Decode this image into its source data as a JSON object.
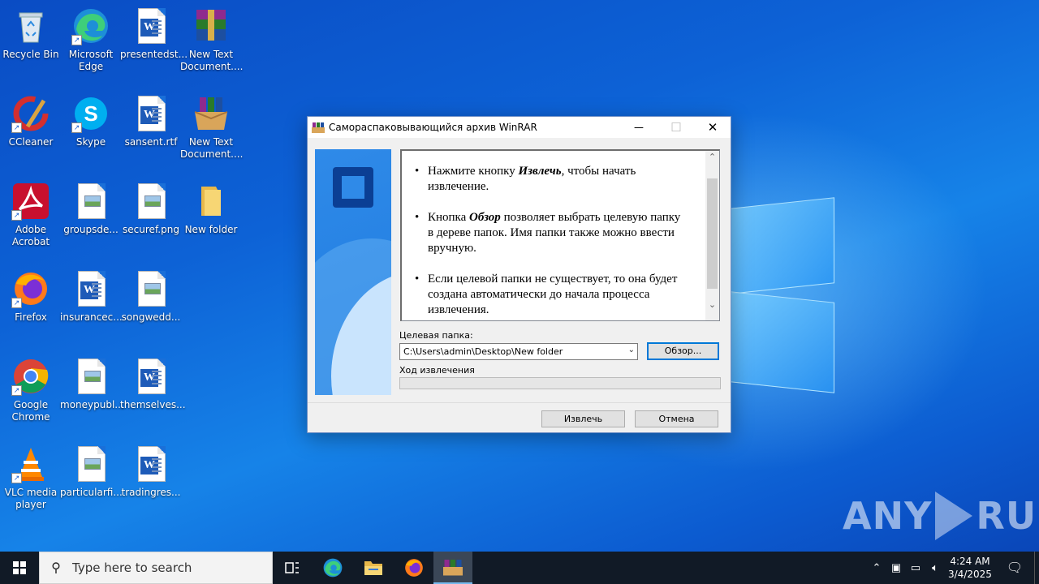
{
  "desktop": {
    "icons": [
      {
        "label": "Recycle Bin",
        "icon": "recycle-bin-icon"
      },
      {
        "label": "Microsoft Edge",
        "icon": "edge-icon"
      },
      {
        "label": "presentedst...",
        "icon": "word-doc-icon"
      },
      {
        "label": "New Text Document....",
        "icon": "winrar-archive-icon"
      },
      {
        "label": "CCleaner",
        "icon": "ccleaner-icon"
      },
      {
        "label": "Skype",
        "icon": "skype-icon"
      },
      {
        "label": "sansent.rtf",
        "icon": "word-doc-icon"
      },
      {
        "label": "New Text Document....",
        "icon": "winrar-archive-icon"
      },
      {
        "label": "Adobe Acrobat",
        "icon": "acrobat-icon"
      },
      {
        "label": "groupsde...",
        "icon": "image-file-icon"
      },
      {
        "label": "securef.png",
        "icon": "image-file-icon"
      },
      {
        "label": "New folder",
        "icon": "folder-icon"
      },
      {
        "label": "Firefox",
        "icon": "firefox-icon"
      },
      {
        "label": "insurancec...",
        "icon": "word-doc-icon"
      },
      {
        "label": "songwedd...",
        "icon": "image-file-icon"
      },
      {
        "label": "Google Chrome",
        "icon": "chrome-icon"
      },
      {
        "label": "moneypubl...",
        "icon": "image-file-icon"
      },
      {
        "label": "themselves...",
        "icon": "word-doc-icon"
      },
      {
        "label": "VLC media player",
        "icon": "vlc-icon"
      },
      {
        "label": "particularfi...",
        "icon": "image-file-icon"
      },
      {
        "label": "tradingres...",
        "icon": "word-doc-icon"
      }
    ]
  },
  "dialog": {
    "title": "Самораспаковывающийся архив WinRAR",
    "bullets": [
      {
        "pre": "Нажмите кнопку ",
        "bold": "Извлечь",
        "post": ", чтобы начать извлечение."
      },
      {
        "pre": "Кнопка ",
        "bold": "Обзор",
        "post": " позволяет выбрать целевую папку в дереве папок. Имя папки также можно ввести вручную."
      },
      {
        "pre": "",
        "bold": "",
        "post": "Если целевой папки не существует, то она будет создана автоматически до начала процесса извлечения."
      }
    ],
    "dest_label": "Целевая папка:",
    "dest_value": "C:\\Users\\admin\\Desktop\\New folder",
    "browse_label": "Обзор...",
    "progress_label": "Ход извлечения",
    "progress": 0,
    "extract_label": "Извлечь",
    "cancel_label": "Отмена"
  },
  "watermark": {
    "left": "ANY",
    "right": "RUN"
  },
  "taskbar": {
    "search_placeholder": "Type here to search",
    "apps": [
      "task-view-icon",
      "edge-icon",
      "file-explorer-icon",
      "firefox-icon",
      "winrar-icon"
    ],
    "active_app": "winrar-icon",
    "time": "4:24 AM",
    "date": "3/4/2025"
  },
  "colors": {
    "accent": "#0078d7",
    "taskbar": "#111a26"
  }
}
